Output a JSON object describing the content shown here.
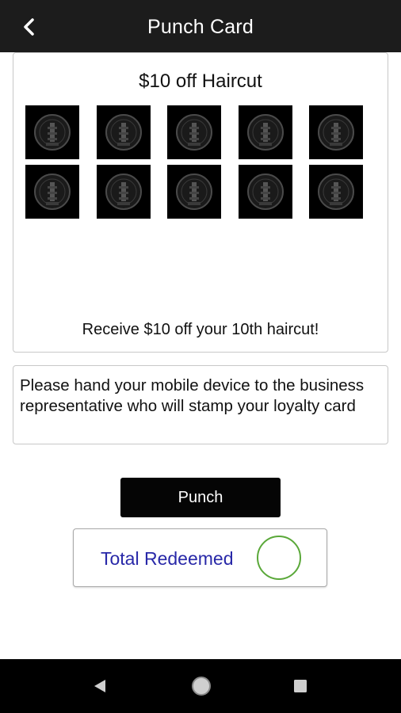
{
  "appbar": {
    "title": "Punch Card",
    "back_icon": "chevron-left-icon"
  },
  "card": {
    "title": "$10 off Haircut",
    "description": "Receive $10 off your 10th haircut!",
    "stamp_count": 10,
    "stamp_icon": "stamp-seal-icon"
  },
  "instructions": {
    "text": "Please hand your mobile device to the business representative who will stamp your loyalty card"
  },
  "punch_button": {
    "label": "Punch"
  },
  "redeemed": {
    "label": "Total Redeemed",
    "value": ""
  },
  "navbar": {
    "back_icon": "triangle-back-icon",
    "home_icon": "circle-home-icon",
    "recents_icon": "square-recents-icon"
  },
  "colors": {
    "appbar_bg": "#1c1c1c",
    "stamp_bg": "#000000",
    "redeemed_text": "#2828a8",
    "redeemed_circle": "#5aa839",
    "navbar_bg": "#000000"
  }
}
